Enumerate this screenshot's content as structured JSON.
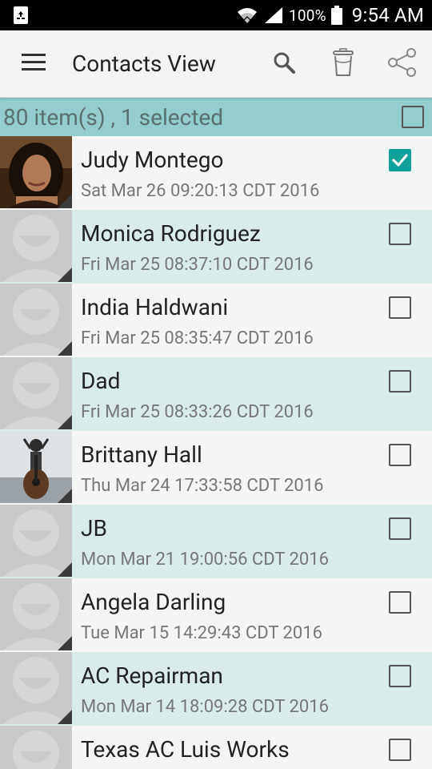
{
  "status_bar": {
    "battery_percent": "100%",
    "time": "9:54 AM",
    "icons": [
      "recycle-notification-icon",
      "wifi-icon",
      "signal-icon",
      "battery-icon"
    ]
  },
  "toolbar": {
    "title": "Contacts View",
    "icons": [
      "menu-icon",
      "search-icon",
      "trash-icon",
      "share-icon"
    ]
  },
  "selection": {
    "summary": "80 item(s) , 1 selected",
    "select_all_checked": false
  },
  "colors": {
    "accent": "#11a09a",
    "header_bar": "#94cdcd",
    "row_even": "#d9ebea",
    "row_odd": "#f4f6f6"
  },
  "contacts": [
    {
      "name": "Judy Montego",
      "date": "Sat Mar 26 09:20:13 CDT 2016",
      "checked": true,
      "avatar": "photo-portrait"
    },
    {
      "name": "Monica Rodriguez",
      "date": "Fri Mar 25 08:37:10 CDT 2016",
      "checked": false,
      "avatar": "default"
    },
    {
      "name": "India Haldwani",
      "date": "Fri Mar 25 08:35:47 CDT 2016",
      "checked": false,
      "avatar": "default"
    },
    {
      "name": "Dad",
      "date": "Fri Mar 25 08:33:26 CDT 2016",
      "checked": false,
      "avatar": "default"
    },
    {
      "name": "Brittany Hall",
      "date": "Thu Mar 24 17:33:58 CDT 2016",
      "checked": false,
      "avatar": "photo-guitar"
    },
    {
      "name": "JB",
      "date": "Mon Mar 21 19:00:56 CDT 2016",
      "checked": false,
      "avatar": "default"
    },
    {
      "name": "Angela Darling",
      "date": "Tue Mar 15 14:29:43 CDT 2016",
      "checked": false,
      "avatar": "default"
    },
    {
      "name": "AC Repairman",
      "date": "Mon Mar 14 18:09:28 CDT 2016",
      "checked": false,
      "avatar": "default"
    },
    {
      "name": "Texas AC Luis Works",
      "date": "",
      "checked": false,
      "avatar": "default"
    }
  ]
}
